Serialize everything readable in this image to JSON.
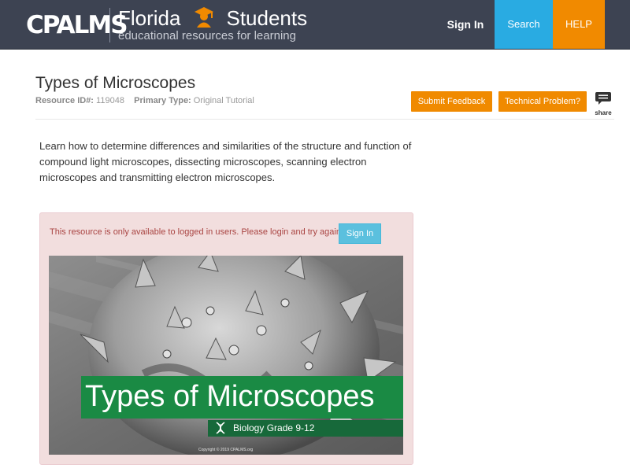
{
  "header": {
    "logo": "CPALMS",
    "brand_title_1": "Florida",
    "brand_title_2": "Students",
    "brand_subtitle": "educational resources for learning",
    "nav": {
      "signin": "Sign In",
      "search": "Search",
      "help": "HELP"
    },
    "colors": {
      "bar": "#3d4352",
      "search": "#29abe2",
      "help": "#f18a00"
    }
  },
  "resource": {
    "title": "Types of Microscopes",
    "id_label": "Resource ID#:",
    "id_value": "119048",
    "type_label": "Primary Type:",
    "type_value": "Original Tutorial",
    "feedback_button": "Submit Feedback",
    "problem_button": "Technical Problem?",
    "share_label": "share",
    "description": "Learn how to determine differences and similarities of the structure and function of compound light microscopes, dissecting microscopes, scanning electron microscopes and transmitting electron microscopes."
  },
  "alert": {
    "message": "This resource is only available to logged in users. Please login and try again.",
    "signin_button": "Sign In"
  },
  "thumbnail": {
    "title": "Types of Microscopes",
    "subtitle": "Biology Grade 9-12",
    "copyright": "Copyright © 2019 CPALMS.org",
    "icon": "dna-icon"
  }
}
